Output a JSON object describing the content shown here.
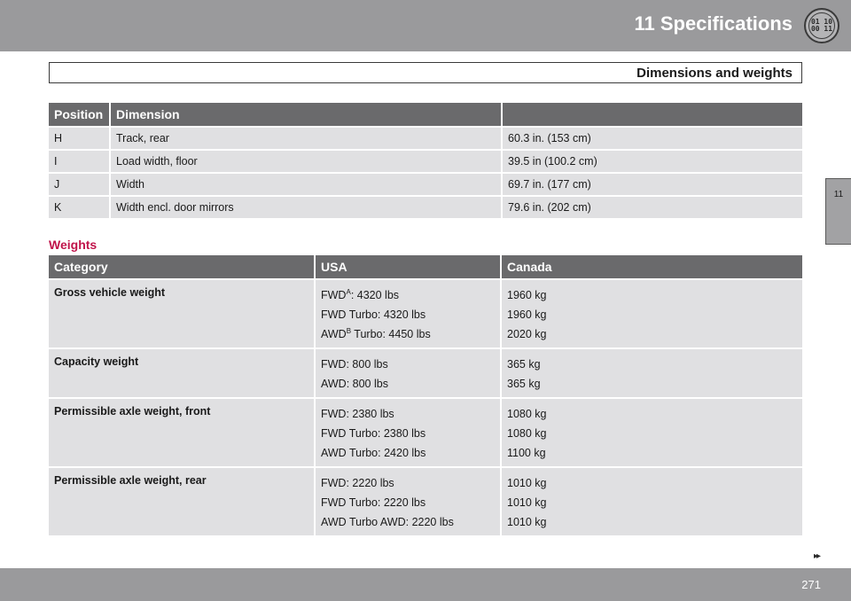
{
  "header": {
    "chapter_title": "11 Specifications",
    "chapter_icon": {
      "name": "chapter-11-icon",
      "line1": "01 10",
      "line2": "00 11"
    },
    "section_title": "Dimensions and weights"
  },
  "side_tab": {
    "label": "11"
  },
  "dimensions_table": {
    "headers": [
      "Position",
      "Dimension",
      ""
    ],
    "rows": [
      {
        "position": "H",
        "dimension": "Track, rear",
        "value": "60.3 in. (153 cm)"
      },
      {
        "position": "I",
        "dimension": "Load width, floor",
        "value": "39.5 in (100.2 cm)"
      },
      {
        "position": "J",
        "dimension": "Width",
        "value": "69.7 in. (177 cm)"
      },
      {
        "position": "K",
        "dimension": "Width encl. door mirrors",
        "value": "79.6 in. (202 cm)"
      }
    ]
  },
  "weights": {
    "heading": "Weights",
    "headers": [
      "Category",
      "USA",
      "Canada"
    ],
    "rows": [
      {
        "category": "Gross vehicle weight",
        "usa": [
          {
            "label": "FWD",
            "sup": "A",
            "value": ": 4320 lbs"
          },
          {
            "label": "FWD Turbo",
            "sup": "",
            "value": ": 4320 lbs"
          },
          {
            "label": "AWD",
            "sup": "B",
            "value": " Turbo: 4450 lbs"
          }
        ],
        "canada": [
          "1960 kg",
          "1960 kg",
          "2020 kg"
        ]
      },
      {
        "category": "Capacity weight",
        "usa": [
          {
            "label": "FWD",
            "sup": "",
            "value": ": 800 lbs"
          },
          {
            "label": "AWD",
            "sup": "",
            "value": ": 800 lbs"
          }
        ],
        "canada": [
          "365 kg",
          "365 kg"
        ]
      },
      {
        "category": "Permissible axle weight, front",
        "usa": [
          {
            "label": "FWD",
            "sup": "",
            "value": ": 2380 lbs"
          },
          {
            "label": "FWD Turbo",
            "sup": "",
            "value": ": 2380 lbs"
          },
          {
            "label": "AWD Turbo",
            "sup": "",
            "value": ": 2420 lbs"
          }
        ],
        "canada": [
          "1080 kg",
          "1080 kg",
          "1100 kg"
        ]
      },
      {
        "category": "Permissible axle weight, rear",
        "usa": [
          {
            "label": "FWD",
            "sup": "",
            "value": ": 2220 lbs"
          },
          {
            "label": "FWD Turbo",
            "sup": "",
            "value": ": 2220 lbs"
          },
          {
            "label": "AWD Turbo AWD",
            "sup": "",
            "value": ": 2220 lbs"
          }
        ],
        "canada": [
          "1010 kg",
          "1010 kg",
          "1010 kg"
        ]
      }
    ]
  },
  "footer": {
    "page_number": "271",
    "next_page_glyph": "▸▸"
  }
}
